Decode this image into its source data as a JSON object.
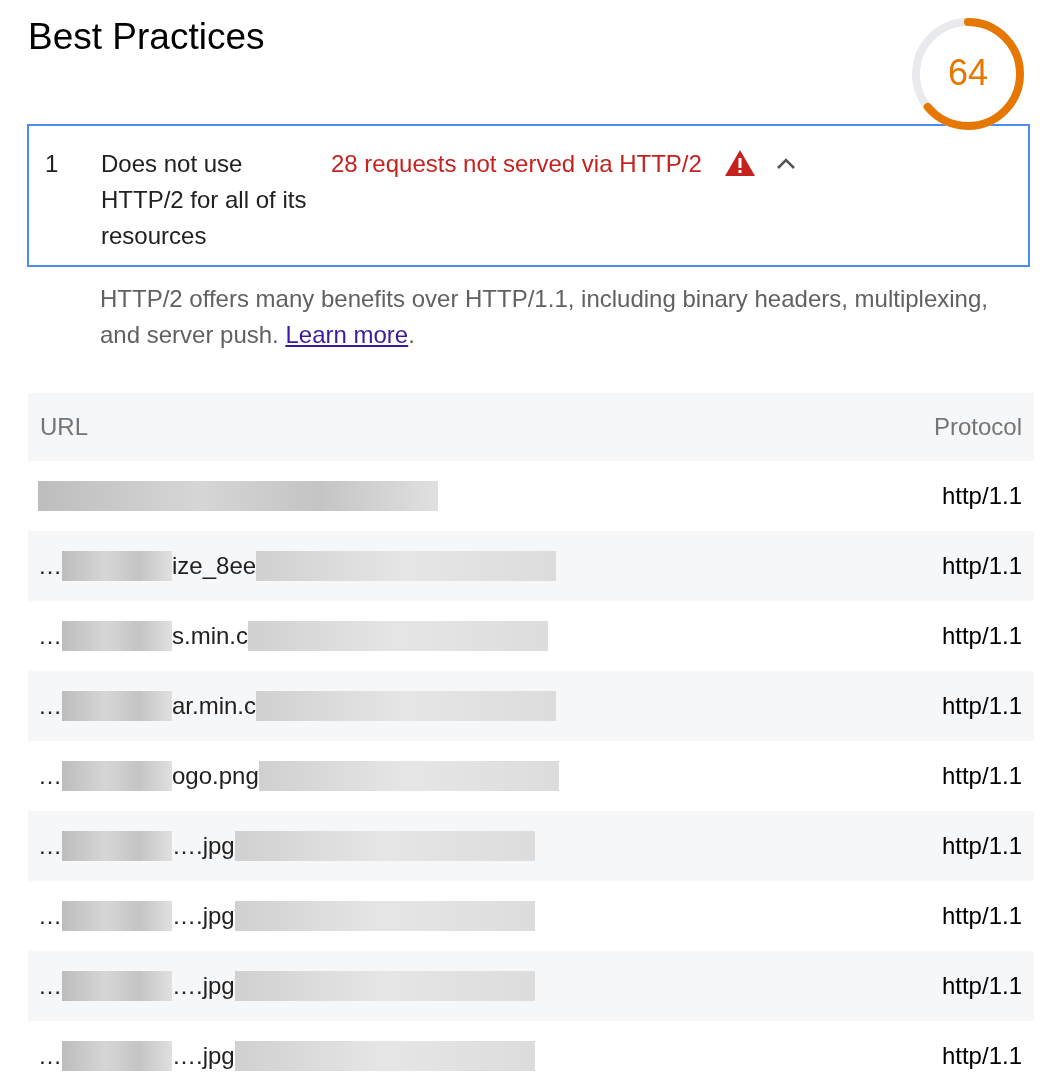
{
  "category": {
    "title": "Best Practices",
    "score": "64",
    "level": 0.64
  },
  "audit": {
    "index": "1",
    "title": "Does not use HTTP/2 for all of its resources",
    "display_value": "28 requests not served via HTTP/2",
    "expanded": true,
    "description": "HTTP/2 offers many benefits over HTTP/1.1, including binary headers, multiplexing, and server push. ",
    "link": "Learn more",
    "link_end": "."
  },
  "table": {
    "columns": [
      "URL",
      "Protocol"
    ],
    "rows": [
      {
        "protocol": "http/1.1"
      },
      {
        "url_prefix": "…",
        "url_fragment": "ize_8ee",
        "protocol": "http/1.1"
      },
      {
        "url_prefix": "…",
        "url_fragment": "s.min.c",
        "protocol": "http/1.1"
      },
      {
        "url_prefix": "…",
        "url_fragment": "ar.min.c",
        "protocol": "http/1.1"
      },
      {
        "url_prefix": "…",
        "url_fragment": "ogo.png",
        "protocol": "http/1.1"
      },
      {
        "url_prefix": "…",
        "url_fragment": "….jpg",
        "protocol": "http/1.1"
      },
      {
        "url_prefix": "…",
        "url_fragment": "….jpg",
        "protocol": "http/1.1"
      },
      {
        "url_prefix": "…",
        "url_fragment": "….jpg",
        "protocol": "http/1.1"
      },
      {
        "url_prefix": "…",
        "url_fragment": "….jpg",
        "protocol": "http/1.1"
      }
    ]
  }
}
